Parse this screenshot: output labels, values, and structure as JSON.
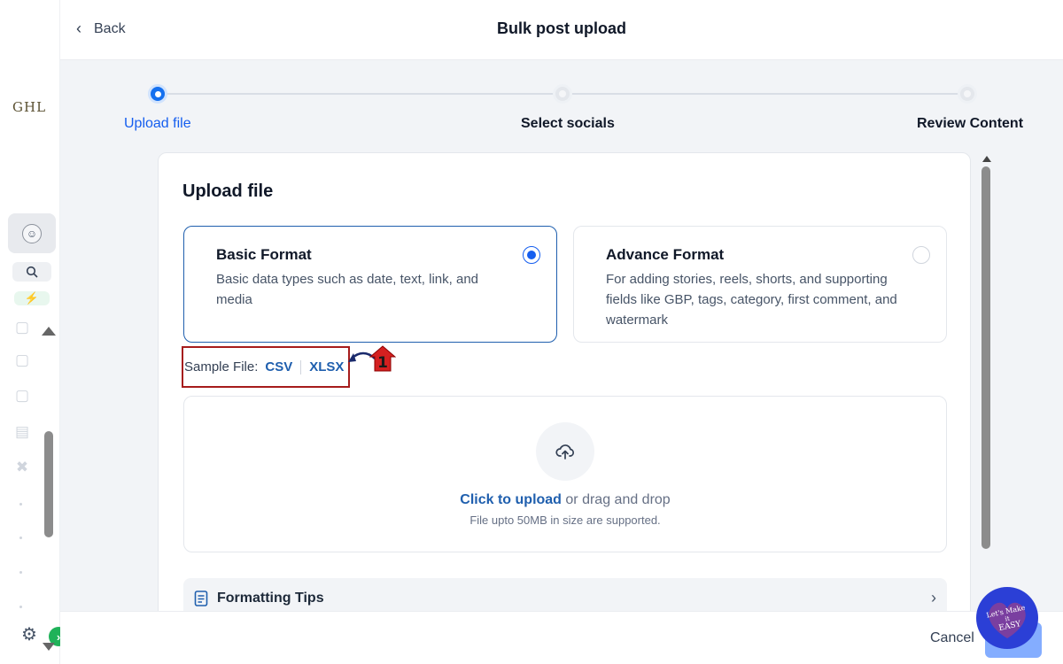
{
  "header": {
    "back_label": "Back",
    "title": "Bulk post upload"
  },
  "sidebar": {
    "logo_text": "GHL"
  },
  "stepper": {
    "steps": [
      {
        "label": "Upload file",
        "state": "active"
      },
      {
        "label": "Select socials",
        "state": "idle"
      },
      {
        "label": "Review Content",
        "state": "idle"
      }
    ]
  },
  "card": {
    "title": "Upload file",
    "options": [
      {
        "title": "Basic Format",
        "description": "Basic data types such as date, text, link, and media",
        "selected": true
      },
      {
        "title": "Advance Format",
        "description": "For adding stories, reels, shorts, and supporting fields like GBP, tags, category, first comment, and watermark",
        "selected": false
      }
    ],
    "sample": {
      "label": "Sample File:",
      "csv": "CSV",
      "xlsx": "XLSX"
    },
    "annotation_number": "1",
    "dropzone": {
      "cta": "Click to upload",
      "rest": " or drag and drop",
      "subtext": "File upto 50MB in size are supported."
    },
    "tips_label": "Formatting Tips"
  },
  "footer": {
    "cancel_label": "Cancel"
  },
  "watermark": {
    "line1": "Let's Make",
    "line2": "it",
    "line3": "EASY"
  },
  "colors": {
    "accent": "#155eef",
    "link": "#1f5fae",
    "annotation_red": "#a61c1c",
    "success_green": "#1fb259"
  }
}
